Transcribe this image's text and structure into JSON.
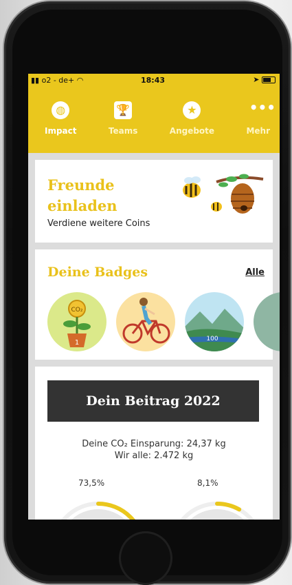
{
  "status": {
    "carrier": "o2 - de+",
    "time": "18:43"
  },
  "nav": {
    "items": [
      {
        "label": "Impact",
        "icon": "globe-icon"
      },
      {
        "label": "Teams",
        "icon": "trophy-icon"
      },
      {
        "label": "Angebote",
        "icon": "star-icon"
      },
      {
        "label": "Mehr",
        "icon": "more-icon"
      }
    ],
    "active": "Impact"
  },
  "invite": {
    "title_line1": "Freunde",
    "title_line2": "einladen",
    "subtitle": "Verdiene weitere Coins"
  },
  "badges": {
    "title": "Deine Badges",
    "all_link": "Alle",
    "items": [
      {
        "label": "CO₂",
        "step": "1"
      },
      {
        "label": "",
        "step": ""
      },
      {
        "label": "100",
        "step": ""
      },
      {
        "label": "",
        "step": ""
      }
    ]
  },
  "contribution": {
    "title": "Dein Beitrag 2022",
    "co2_line": "Deine CO₂ Einsparung: 24,37 kg",
    "all_line": "Wir alle: 2.472 kg",
    "gauges": [
      {
        "percent_label": "73,5%",
        "fraction": 0.735
      },
      {
        "percent_label": "8,1%",
        "fraction": 0.081
      }
    ]
  },
  "colors": {
    "brand_yellow": "#eac71d",
    "dark": "#333333"
  }
}
